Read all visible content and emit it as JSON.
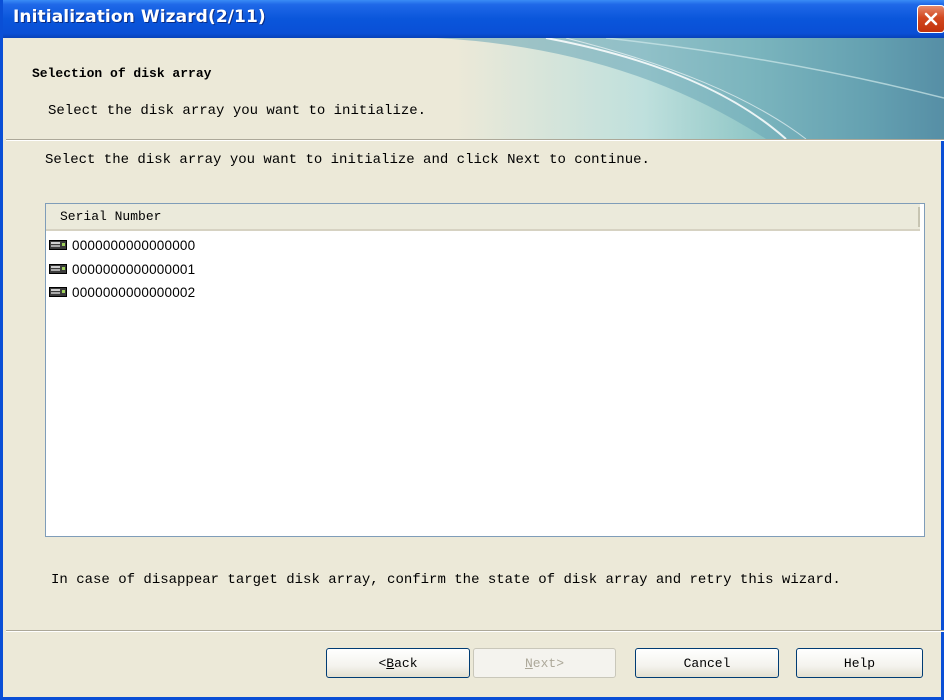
{
  "window": {
    "title": "Initialization Wizard(2/11)"
  },
  "banner": {
    "title": "Selection of disk array",
    "subtitle": "Select the disk array you want to initialize."
  },
  "main": {
    "instruction": "Select the disk array you want to initialize and click Next to continue.",
    "list": {
      "column_header": "Serial Number",
      "items": [
        {
          "icon": "disk-array-icon",
          "serial": "0000000000000000"
        },
        {
          "icon": "disk-array-icon",
          "serial": "0000000000000001"
        },
        {
          "icon": "disk-array-icon",
          "serial": "0000000000000002"
        }
      ]
    },
    "note": "In case of disappear target disk array, confirm the state of disk array and retry this wizard."
  },
  "buttons": {
    "back": {
      "prefix": "< ",
      "mnemonic": "B",
      "rest": "ack",
      "enabled": true
    },
    "next": {
      "mnemonic": "N",
      "rest": "ext",
      "suffix": " >",
      "enabled": false
    },
    "cancel": {
      "label": "Cancel",
      "enabled": true
    },
    "help": {
      "label": "Help",
      "enabled": true
    }
  },
  "colors": {
    "titlebar": "#0a4fd6",
    "close_button": "#d2481f",
    "dialog_background": "#ece9d8",
    "list_border": "#7f9db9"
  }
}
